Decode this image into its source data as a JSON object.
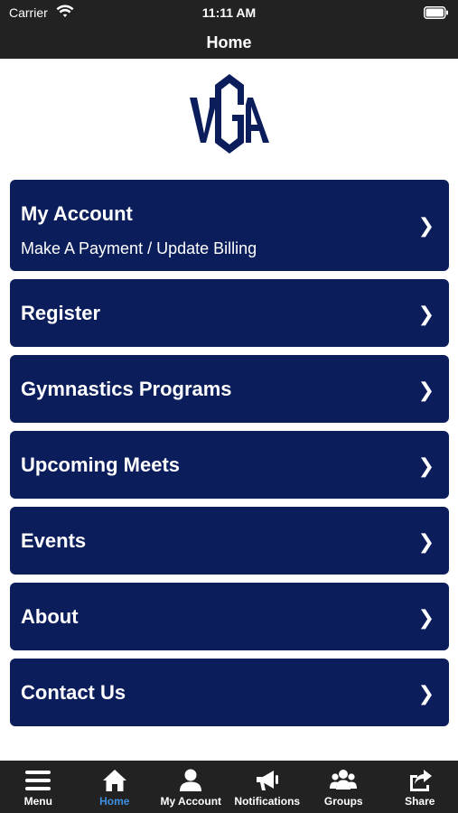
{
  "status_bar": {
    "carrier": "Carrier",
    "time": "11:11 AM"
  },
  "nav": {
    "title": "Home"
  },
  "logo": {
    "text": "VGA",
    "color": "#0b1e5b"
  },
  "menu": [
    {
      "label": "My Account",
      "sublabel": "Make A Payment / Update Billing",
      "chevron": "❯"
    },
    {
      "label": "Register",
      "chevron": "❯"
    },
    {
      "label": "Gymnastics Programs",
      "chevron": "❯"
    },
    {
      "label": "Upcoming Meets",
      "chevron": "❯"
    },
    {
      "label": "Events",
      "chevron": "❯"
    },
    {
      "label": "About",
      "chevron": "❯"
    },
    {
      "label": "Contact Us",
      "chevron": "❯"
    }
  ],
  "tabs": [
    {
      "label": "Menu",
      "icon": "menu-icon"
    },
    {
      "label": "Home",
      "icon": "home-icon",
      "active": true
    },
    {
      "label": "My Account",
      "icon": "user-icon"
    },
    {
      "label": "Notifications",
      "icon": "megaphone-icon"
    },
    {
      "label": "Groups",
      "icon": "groups-icon"
    },
    {
      "label": "Share",
      "icon": "share-icon"
    }
  ],
  "colors": {
    "card": "#0b1e5b",
    "bar": "#222222",
    "active_tab": "#3d8fe0"
  }
}
